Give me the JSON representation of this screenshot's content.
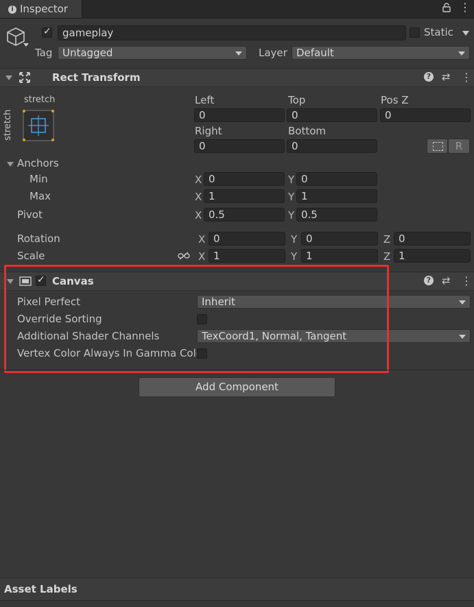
{
  "tab": {
    "title": "Inspector"
  },
  "object": {
    "name": "gameplay",
    "active": true,
    "static_label": "Static",
    "static": false,
    "tag_label": "Tag",
    "tag_value": "Untagged",
    "layer_label": "Layer",
    "layer_value": "Default"
  },
  "rect_transform": {
    "title": "Rect Transform",
    "preset_h": "stretch",
    "preset_v": "stretch",
    "left_label": "Left",
    "left": "0",
    "top_label": "Top",
    "top": "0",
    "posz_label": "Pos Z",
    "posz": "0",
    "right_label": "Right",
    "right": "0",
    "bottom_label": "Bottom",
    "bottom": "0",
    "r_button": "R",
    "anchors_label": "Anchors",
    "min_label": "Min",
    "min_x": "0",
    "min_y": "0",
    "max_label": "Max",
    "max_x": "1",
    "max_y": "1",
    "pivot_label": "Pivot",
    "pivot_x": "0.5",
    "pivot_y": "0.5",
    "rotation_label": "Rotation",
    "rot_x": "0",
    "rot_y": "0",
    "rot_z": "0",
    "scale_label": "Scale",
    "scale_x": "1",
    "scale_y": "1",
    "scale_z": "1",
    "axis_x": "X",
    "axis_y": "Y",
    "axis_z": "Z"
  },
  "canvas": {
    "title": "Canvas",
    "enabled": true,
    "pixel_perfect_label": "Pixel Perfect",
    "pixel_perfect_value": "Inherit",
    "override_sorting_label": "Override Sorting",
    "shader_channels_label": "Additional Shader Channels",
    "shader_channels_value": "TexCoord1, Normal, Tangent",
    "vertex_color_label": "Vertex Color Always In Gamma Color"
  },
  "add_component": "Add Component",
  "asset_labels": "Asset Labels",
  "highlight_color": "#e53030"
}
